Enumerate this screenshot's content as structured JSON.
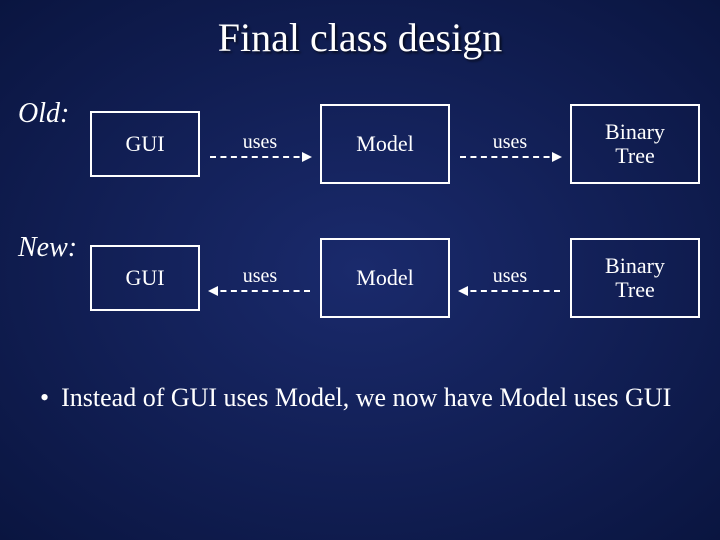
{
  "title": "Final class design",
  "old_label": "Old:",
  "new_label": "New:",
  "old": {
    "box1": "GUI",
    "arrow1": "uses",
    "box2": "Model",
    "arrow2": "uses",
    "box3": "Binary\nTree"
  },
  "new": {
    "box1": "GUI",
    "arrow1": "uses",
    "box2": "Model",
    "arrow2": "uses",
    "box3": "Binary\nTree"
  },
  "bullet": "Instead of GUI uses Model, we now have Model uses GUI",
  "chart_data": {
    "type": "diagram",
    "title": "Final class design",
    "rows": [
      {
        "label": "Old:",
        "nodes": [
          "GUI",
          "Model",
          "Binary Tree"
        ],
        "edges": [
          {
            "from": "GUI",
            "to": "Model",
            "label": "uses",
            "direction": "right"
          },
          {
            "from": "Model",
            "to": "Binary Tree",
            "label": "uses",
            "direction": "right"
          }
        ]
      },
      {
        "label": "New:",
        "nodes": [
          "GUI",
          "Model",
          "Binary Tree"
        ],
        "edges": [
          {
            "from": "Model",
            "to": "GUI",
            "label": "uses",
            "direction": "left"
          },
          {
            "from": "Binary Tree",
            "to": "Model",
            "label": "uses",
            "direction": "left"
          }
        ]
      }
    ],
    "annotations": [
      "Instead of GUI uses Model, we now have Model uses GUI"
    ]
  }
}
